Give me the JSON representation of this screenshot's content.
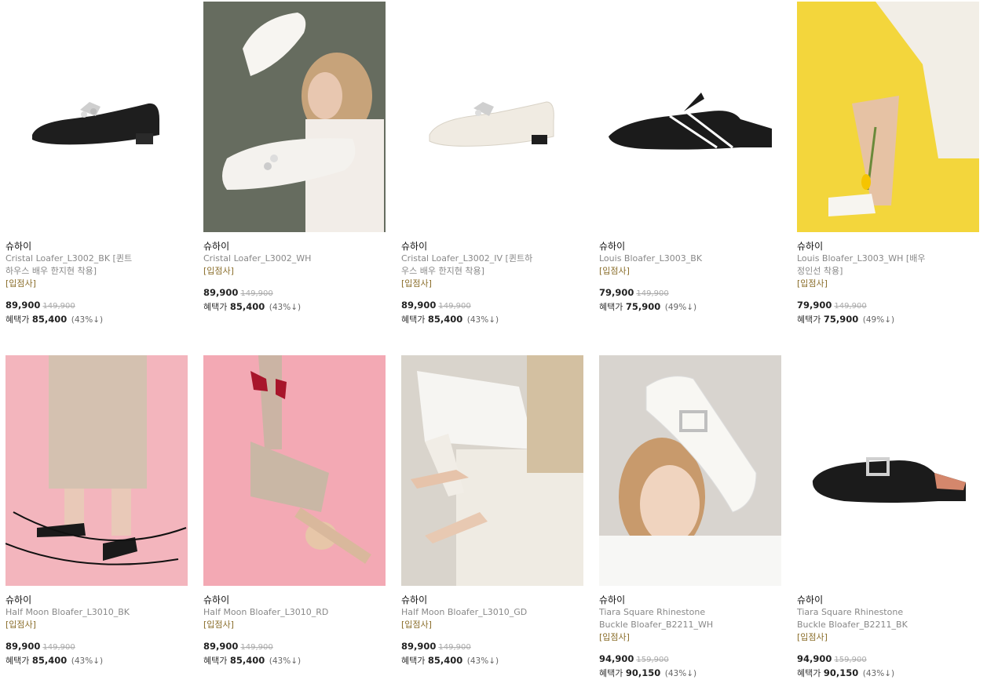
{
  "products": [
    {
      "brand": "슈하이",
      "name": "Cristal Loafer_L3002_BK [퀸트하우스 배우 한지현 착용]",
      "tag": "[입점사]",
      "price": "89,900",
      "original": "149,900",
      "benefit_label": "혜택가",
      "benefit_price": "85,400",
      "discount": "(43%↓)",
      "image_icon": "black-loafer-product-image"
    },
    {
      "brand": "슈하이",
      "name": "Cristal Loafer_L3002_WH",
      "tag": "[입점사]",
      "price": "89,900",
      "original": "149,900",
      "benefit_label": "혜택가",
      "benefit_price": "85,400",
      "discount": "(43%↓)",
      "image_icon": "model-holding-white-loafers-image"
    },
    {
      "brand": "슈하이",
      "name": "Cristal Loafer_L3002_IV [퀸트하우스 배우 한지현 착용]",
      "tag": "[입점사]",
      "price": "89,900",
      "original": "149,900",
      "benefit_label": "혜택가",
      "benefit_price": "85,400",
      "discount": "(43%↓)",
      "image_icon": "ivory-loafer-product-image"
    },
    {
      "brand": "슈하이",
      "name": "Louis Bloafer_L3003_BK",
      "tag": "[입점사]",
      "price": "79,900",
      "original": "149,900",
      "benefit_label": "혜택가",
      "benefit_price": "75,900",
      "discount": "(49%↓)",
      "image_icon": "black-bloafer-product-image"
    },
    {
      "brand": "슈하이",
      "name": "Louis Bloafer_L3003_WH [배우 정인선 착용]",
      "tag": "[입점사]",
      "price": "79,900",
      "original": "149,900",
      "benefit_label": "혜택가",
      "benefit_price": "75,900",
      "discount": "(49%↓)",
      "image_icon": "model-yellow-background-image"
    },
    {
      "brand": "슈하이",
      "name": "Half Moon Bloafer_L3010_BK",
      "tag": "[입점사]",
      "price": "89,900",
      "original": "149,900",
      "benefit_label": "혜택가",
      "benefit_price": "85,400",
      "discount": "(43%↓)",
      "image_icon": "model-pink-background-black-shoes-image"
    },
    {
      "brand": "슈하이",
      "name": "Half Moon Bloafer_L3010_RD",
      "tag": "[입점사]",
      "price": "89,900",
      "original": "149,900",
      "benefit_label": "혜택가",
      "benefit_price": "85,400",
      "discount": "(43%↓)",
      "image_icon": "model-lying-red-shoes-image"
    },
    {
      "brand": "슈하이",
      "name": "Half Moon Bloafer_L3010_GD",
      "tag": "[입점사]",
      "price": "89,900",
      "original": "149,900",
      "benefit_label": "혜택가",
      "benefit_price": "85,400",
      "discount": "(43%↓)",
      "image_icon": "model-beige-shoes-image"
    },
    {
      "brand": "슈하이",
      "name": "Tiara Square Rhinestone Buckle Bloafer_B2211_WH",
      "tag": "[입점사]",
      "price": "94,900",
      "original": "159,900",
      "benefit_label": "혜택가",
      "benefit_price": "90,150",
      "discount": "(43%↓)",
      "image_icon": "model-white-bloafer-image"
    },
    {
      "brand": "슈하이",
      "name": "Tiara Square Rhinestone Buckle Bloafer_B2211_BK",
      "tag": "[입점사]",
      "price": "94,900",
      "original": "159,900",
      "benefit_label": "혜택가",
      "benefit_price": "90,150",
      "discount": "(43%↓)",
      "image_icon": "black-buckle-bloafer-product-image"
    }
  ]
}
